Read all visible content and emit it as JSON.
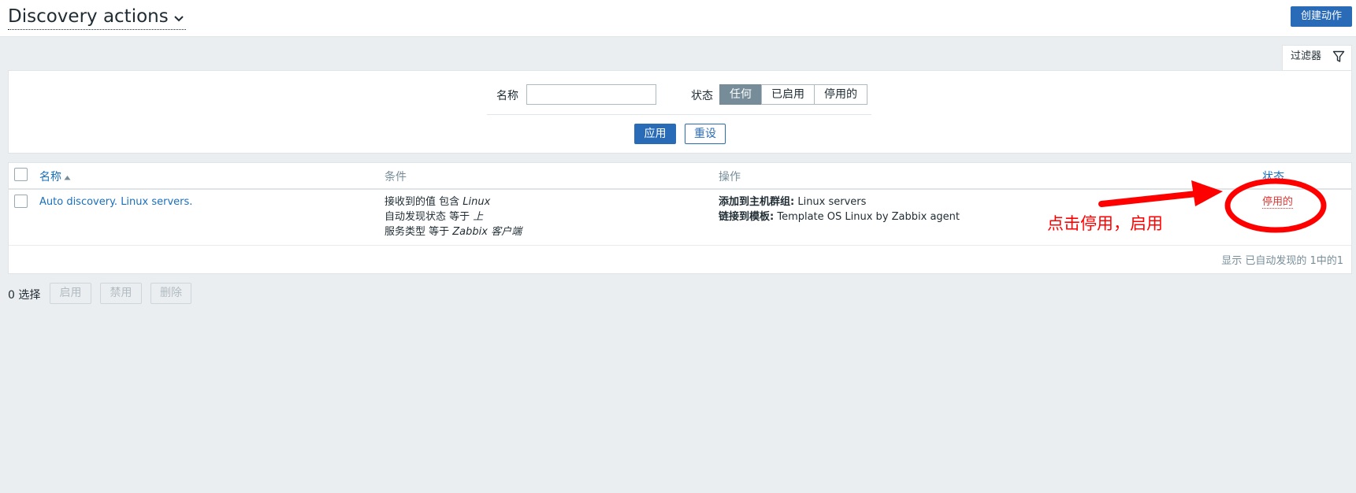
{
  "header": {
    "title": "Discovery actions",
    "create_button": "创建动作"
  },
  "filter": {
    "tab_label": "过滤器",
    "name_label": "名称",
    "name_value": "",
    "status_label": "状态",
    "status_options": [
      "任何",
      "已启用",
      "停用的"
    ],
    "status_selected": "任何",
    "apply_label": "应用",
    "reset_label": "重设"
  },
  "table": {
    "columns": {
      "name": "名称",
      "conditions": "条件",
      "operations": "操作",
      "status": "状态"
    },
    "rows": [
      {
        "name": "Auto discovery. Linux servers.",
        "conditions": [
          {
            "prefix": "接收到的值 包含 ",
            "value": "Linux"
          },
          {
            "prefix": "自动发现状态 等于 ",
            "value": "上"
          },
          {
            "prefix": "服务类型 等于 ",
            "value": "Zabbix 客户端"
          }
        ],
        "operations": [
          {
            "label": "添加到主机群组:",
            "value": " Linux servers"
          },
          {
            "label": "链接到模板:",
            "value": " Template OS Linux by Zabbix agent"
          }
        ],
        "status": "停用的"
      }
    ],
    "footer": "显示 已自动发现的 1中的1"
  },
  "actions": {
    "selected": "0 选择",
    "enable": "启用",
    "disable": "禁用",
    "delete": "删除"
  },
  "annotation": {
    "text": "点击停用，启用",
    "color": "#ff0000"
  },
  "colors": {
    "primary": "#2a6bb8",
    "link": "#1a6fbb",
    "disabled_status": "#e33734",
    "background": "#ebeef0"
  }
}
